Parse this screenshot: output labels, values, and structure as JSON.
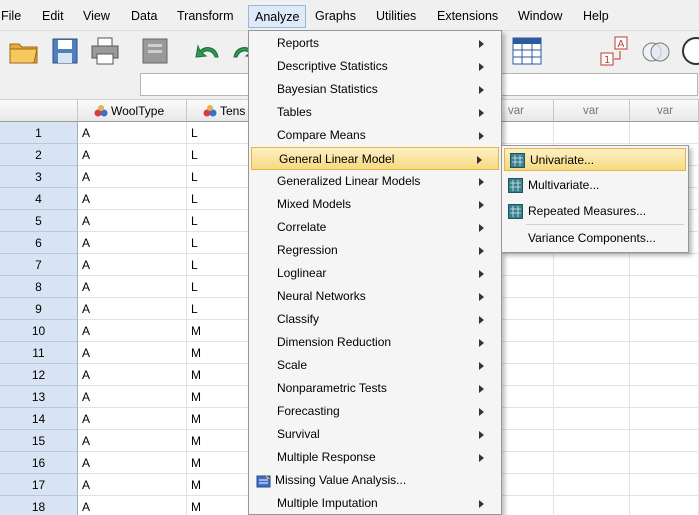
{
  "menubar": {
    "items": [
      "File",
      "Edit",
      "View",
      "Data",
      "Transform",
      "Analyze",
      "Graphs",
      "Utilities",
      "Extensions",
      "Window",
      "Help"
    ],
    "active": "Analyze"
  },
  "toolbar": {
    "icons": [
      "open-folder-icon",
      "save-icon",
      "print-icon",
      "dialog-recall-icon",
      "undo-icon",
      "redo-icon",
      "data-grid-icon",
      "value-labels-icon",
      "sets-icon"
    ]
  },
  "grid": {
    "columns": [
      {
        "name": "WoolType",
        "type": "nominal"
      },
      {
        "name": "Tens",
        "type": "nominal"
      }
    ],
    "var_label": "var",
    "rows": [
      {
        "n": "1",
        "c1": "A",
        "c2": "L"
      },
      {
        "n": "2",
        "c1": "A",
        "c2": "L"
      },
      {
        "n": "3",
        "c1": "A",
        "c2": "L"
      },
      {
        "n": "4",
        "c1": "A",
        "c2": "L"
      },
      {
        "n": "5",
        "c1": "A",
        "c2": "L"
      },
      {
        "n": "6",
        "c1": "A",
        "c2": "L"
      },
      {
        "n": "7",
        "c1": "A",
        "c2": "L"
      },
      {
        "n": "8",
        "c1": "A",
        "c2": "L"
      },
      {
        "n": "9",
        "c1": "A",
        "c2": "L"
      },
      {
        "n": "10",
        "c1": "A",
        "c2": "M"
      },
      {
        "n": "11",
        "c1": "A",
        "c2": "M"
      },
      {
        "n": "12",
        "c1": "A",
        "c2": "M"
      },
      {
        "n": "13",
        "c1": "A",
        "c2": "M"
      },
      {
        "n": "14",
        "c1": "A",
        "c2": "M"
      },
      {
        "n": "15",
        "c1": "A",
        "c2": "M"
      },
      {
        "n": "16",
        "c1": "A",
        "c2": "M"
      },
      {
        "n": "17",
        "c1": "A",
        "c2": "M"
      },
      {
        "n": "18",
        "c1": "A",
        "c2": "M"
      }
    ]
  },
  "analyze_menu": {
    "items": [
      {
        "label": "Reports",
        "submenu": true
      },
      {
        "label": "Descriptive Statistics",
        "submenu": true
      },
      {
        "label": "Bayesian Statistics",
        "submenu": true
      },
      {
        "label": "Tables",
        "submenu": true
      },
      {
        "label": "Compare Means",
        "submenu": true
      },
      {
        "label": "General Linear Model",
        "submenu": true,
        "highlighted": true
      },
      {
        "label": "Generalized Linear Models",
        "submenu": true
      },
      {
        "label": "Mixed Models",
        "submenu": true
      },
      {
        "label": "Correlate",
        "submenu": true
      },
      {
        "label": "Regression",
        "submenu": true
      },
      {
        "label": "Loglinear",
        "submenu": true
      },
      {
        "label": "Neural Networks",
        "submenu": true
      },
      {
        "label": "Classify",
        "submenu": true
      },
      {
        "label": "Dimension Reduction",
        "submenu": true
      },
      {
        "label": "Scale",
        "submenu": true
      },
      {
        "label": "Nonparametric Tests",
        "submenu": true
      },
      {
        "label": "Forecasting",
        "submenu": true
      },
      {
        "label": "Survival",
        "submenu": true
      },
      {
        "label": "Multiple Response",
        "submenu": true
      },
      {
        "label": "Missing Value Analysis...",
        "submenu": false,
        "icon": "missing-value-icon"
      },
      {
        "label": "Multiple Imputation",
        "submenu": true
      }
    ]
  },
  "glm_submenu": {
    "items": [
      {
        "label": "Univariate...",
        "icon": "univariate-icon",
        "highlighted": true
      },
      {
        "label": "Multivariate...",
        "icon": "multivariate-icon"
      },
      {
        "label": "Repeated Measures...",
        "icon": "repeated-measures-icon"
      },
      {
        "label": "Variance Components...",
        "icon": ""
      }
    ]
  },
  "colors": {
    "highlight": "#f7d980",
    "row_header": "#d8e4f3",
    "menu_bg": "#f5f5f5"
  }
}
